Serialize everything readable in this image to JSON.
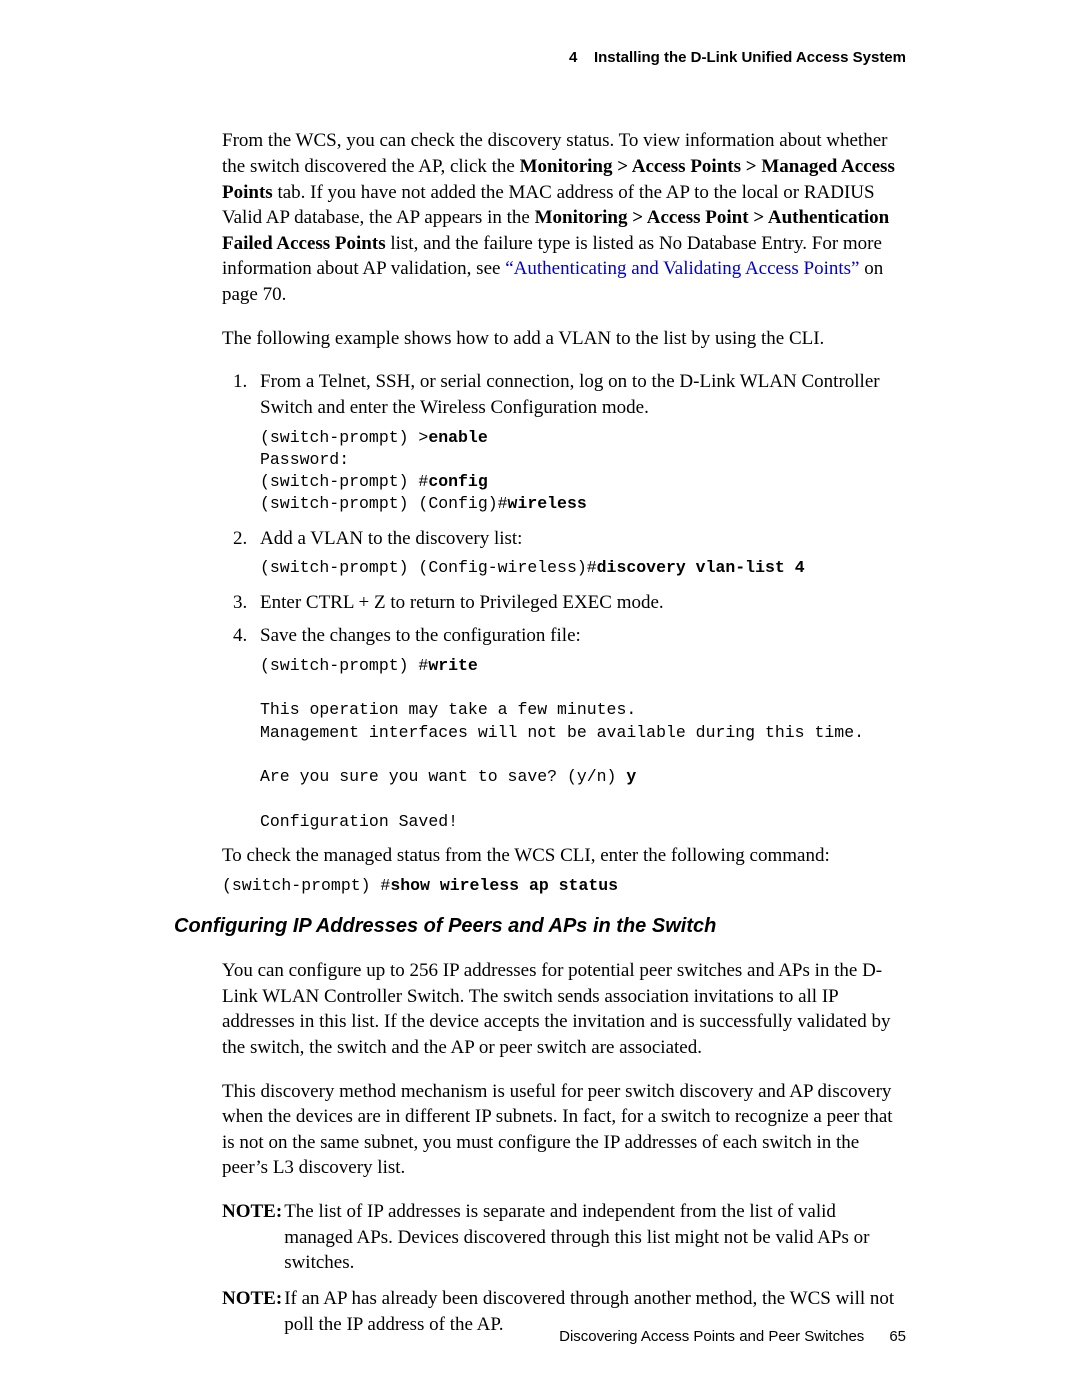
{
  "header": {
    "chapter_number": "4",
    "chapter_title": "Installing the D-Link Unified Access System"
  },
  "intro": {
    "p1_a": "From the WCS, you can check the discovery status. To view information about whether the switch discovered the AP, click the ",
    "p1_b_bold": "Monitoring > Access Points > Managed Access Points",
    "p1_c": " tab. If you have not added the MAC address of the AP to the local or RADIUS Valid AP database, the AP appears in the ",
    "p1_d_bold": "Monitoring > Access Point > Authentication Failed Access Points",
    "p1_e": " list, and the failure type is listed as No Database Entry. For more information about AP validation, see ",
    "p1_link": "“Authenticating and Validating Access Points”",
    "p1_f": " on page 70.",
    "p2": "The following example shows how to add a VLAN to the list by using the CLI."
  },
  "steps": {
    "s1_text": "From a Telnet, SSH, or serial connection, log on to the D-Link WLAN Controller Switch and enter the Wireless Configuration mode.",
    "s1_code_l1a": "(switch-prompt) >",
    "s1_code_l1b": "enable",
    "s1_code_l2": "Password:",
    "s1_code_l3a": "(switch-prompt) #",
    "s1_code_l3b": "config",
    "s1_code_l4a": "(switch-prompt) (Config)#",
    "s1_code_l4b": "wireless",
    "s2_text": "Add a VLAN to the discovery list:",
    "s2_code_a": "(switch-prompt) (Config-wireless)#",
    "s2_code_b": "discovery vlan-list 4",
    "s3_text": "Enter CTRL + Z to return to Privileged EXEC mode.",
    "s4_text": "Save the changes to the configuration file:",
    "s4_code_l1a": "(switch-prompt) #",
    "s4_code_l1b": "write",
    "s4_code_l2": "This operation may take a few minutes.",
    "s4_code_l3": "Management interfaces will not be available during this time.",
    "s4_code_l4a": "Are you sure you want to save? (y/n) ",
    "s4_code_l4b": "y",
    "s4_code_l5": "Configuration Saved!"
  },
  "after_steps": {
    "p1": "To check the managed status from the WCS CLI, enter the following command:",
    "code_a": "(switch-prompt) #",
    "code_b": "show wireless ap status"
  },
  "section": {
    "heading": "Configuring IP Addresses of Peers and APs in the Switch",
    "p1": "You can configure up to 256 IP addresses for potential peer switches and APs in the D-Link WLAN Controller Switch. The switch sends association invitations to all IP addresses in this list. If the device accepts the invitation and is successfully validated by the switch, the switch and the AP or peer switch are associated.",
    "p2": "This discovery method mechanism is useful for peer switch discovery and AP discovery when the devices are in different IP subnets. In fact, for a switch to recognize a peer that is not on the same subnet, you must configure the IP addresses of each switch in the peer’s L3 discovery list.",
    "note_label": "NOTE:",
    "note1": "The list of IP addresses is separate and independent from the list of valid managed APs. Devices discovered through this list might not be valid APs or switches.",
    "note2": "If an AP has already been discovered through another method, the WCS will not poll the IP address of the AP."
  },
  "footer": {
    "section_name": "Discovering Access Points and Peer Switches",
    "page_number": "65"
  }
}
